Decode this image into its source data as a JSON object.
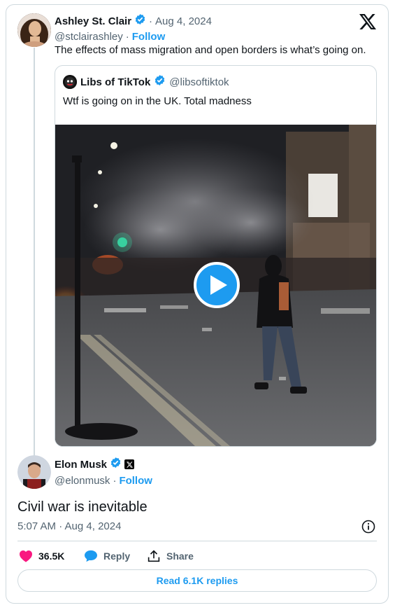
{
  "original_post": {
    "author_name": "Ashley St. Clair",
    "date": "Aug 4, 2024",
    "separator": "·",
    "handle": "@stclairashley",
    "follow_label": "Follow",
    "text": "The effects of mass migration and open borders is what’s going on."
  },
  "quoted_post": {
    "author_name": "Libs of TikTok",
    "handle": "@libsoftiktok",
    "text": "Wtf is going on in the UK. Total madness"
  },
  "reply_post": {
    "author_name": "Elon Musk",
    "handle": "@elonmusk",
    "separator": "·",
    "follow_label": "Follow",
    "text": "Civil war is inevitable",
    "timestamp": "5:07 AM · Aug 4, 2024"
  },
  "actions": {
    "likes": "36.5K",
    "reply_label": "Reply",
    "share_label": "Share",
    "read_replies_label": "Read 6.1K replies"
  },
  "icons": {
    "platform_logo": "x-logo-icon",
    "verified": "verified-badge-icon",
    "info": "info-icon",
    "heart": "heart-icon",
    "reply": "reply-bubble-icon",
    "share": "share-upload-icon",
    "play": "play-icon"
  },
  "colors": {
    "accent": "#1d9bf0",
    "like": "#f91880",
    "text_secondary": "#536471",
    "border": "#cfd9de"
  }
}
